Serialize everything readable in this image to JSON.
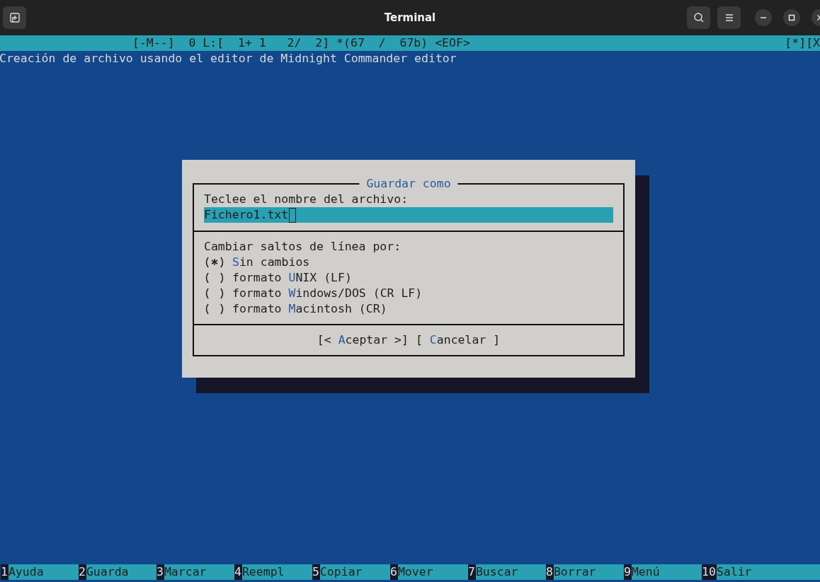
{
  "window": {
    "title": "Terminal"
  },
  "editor": {
    "status_line": "[-M--]  0 L:[  1+ 1   2/  2] *(67  /  67b) <EOF>",
    "status_right": "[*][X",
    "lines": [
      "Creación de archivo usando el editor de Midnight Commander editor"
    ]
  },
  "dialog": {
    "title": "Guardar como",
    "prompt": "Teclee el nombre del archivo:",
    "filename": {
      "value": "Fichero1.txt"
    },
    "group_label": "Cambiar saltos de línea por:",
    "options": [
      {
        "hotkey": "S",
        "suffix": "in cambios",
        "selected": true
      },
      {
        "prefix": "formato ",
        "hotkey": "U",
        "suffix": "NIX (LF)",
        "selected": false
      },
      {
        "prefix": "formato ",
        "hotkey": "W",
        "suffix": "indows/DOS (CR LF)",
        "selected": false
      },
      {
        "prefix": "formato ",
        "hotkey": "M",
        "suffix": "acintosh (CR)",
        "selected": false
      }
    ],
    "buttons": [
      {
        "prefix": "[< ",
        "hotkey": "A",
        "suffix": "ceptar >]"
      },
      {
        "prefix": "[ ",
        "hotkey": "C",
        "suffix": "ancelar ]"
      }
    ]
  },
  "function_keys": [
    {
      "key": "1",
      "label": "Ayuda"
    },
    {
      "key": "2",
      "label": "Guarda"
    },
    {
      "key": "3",
      "label": "Marcar"
    },
    {
      "key": "4",
      "label": "Reempl"
    },
    {
      "key": "5",
      "label": "Copiar"
    },
    {
      "key": "6",
      "label": "Mover"
    },
    {
      "key": "7",
      "label": "Buscar"
    },
    {
      "key": "8",
      "label": "Borrar"
    },
    {
      "key": "9",
      "label": "Menú"
    },
    {
      "key": "10",
      "label": "Salir"
    }
  ]
}
